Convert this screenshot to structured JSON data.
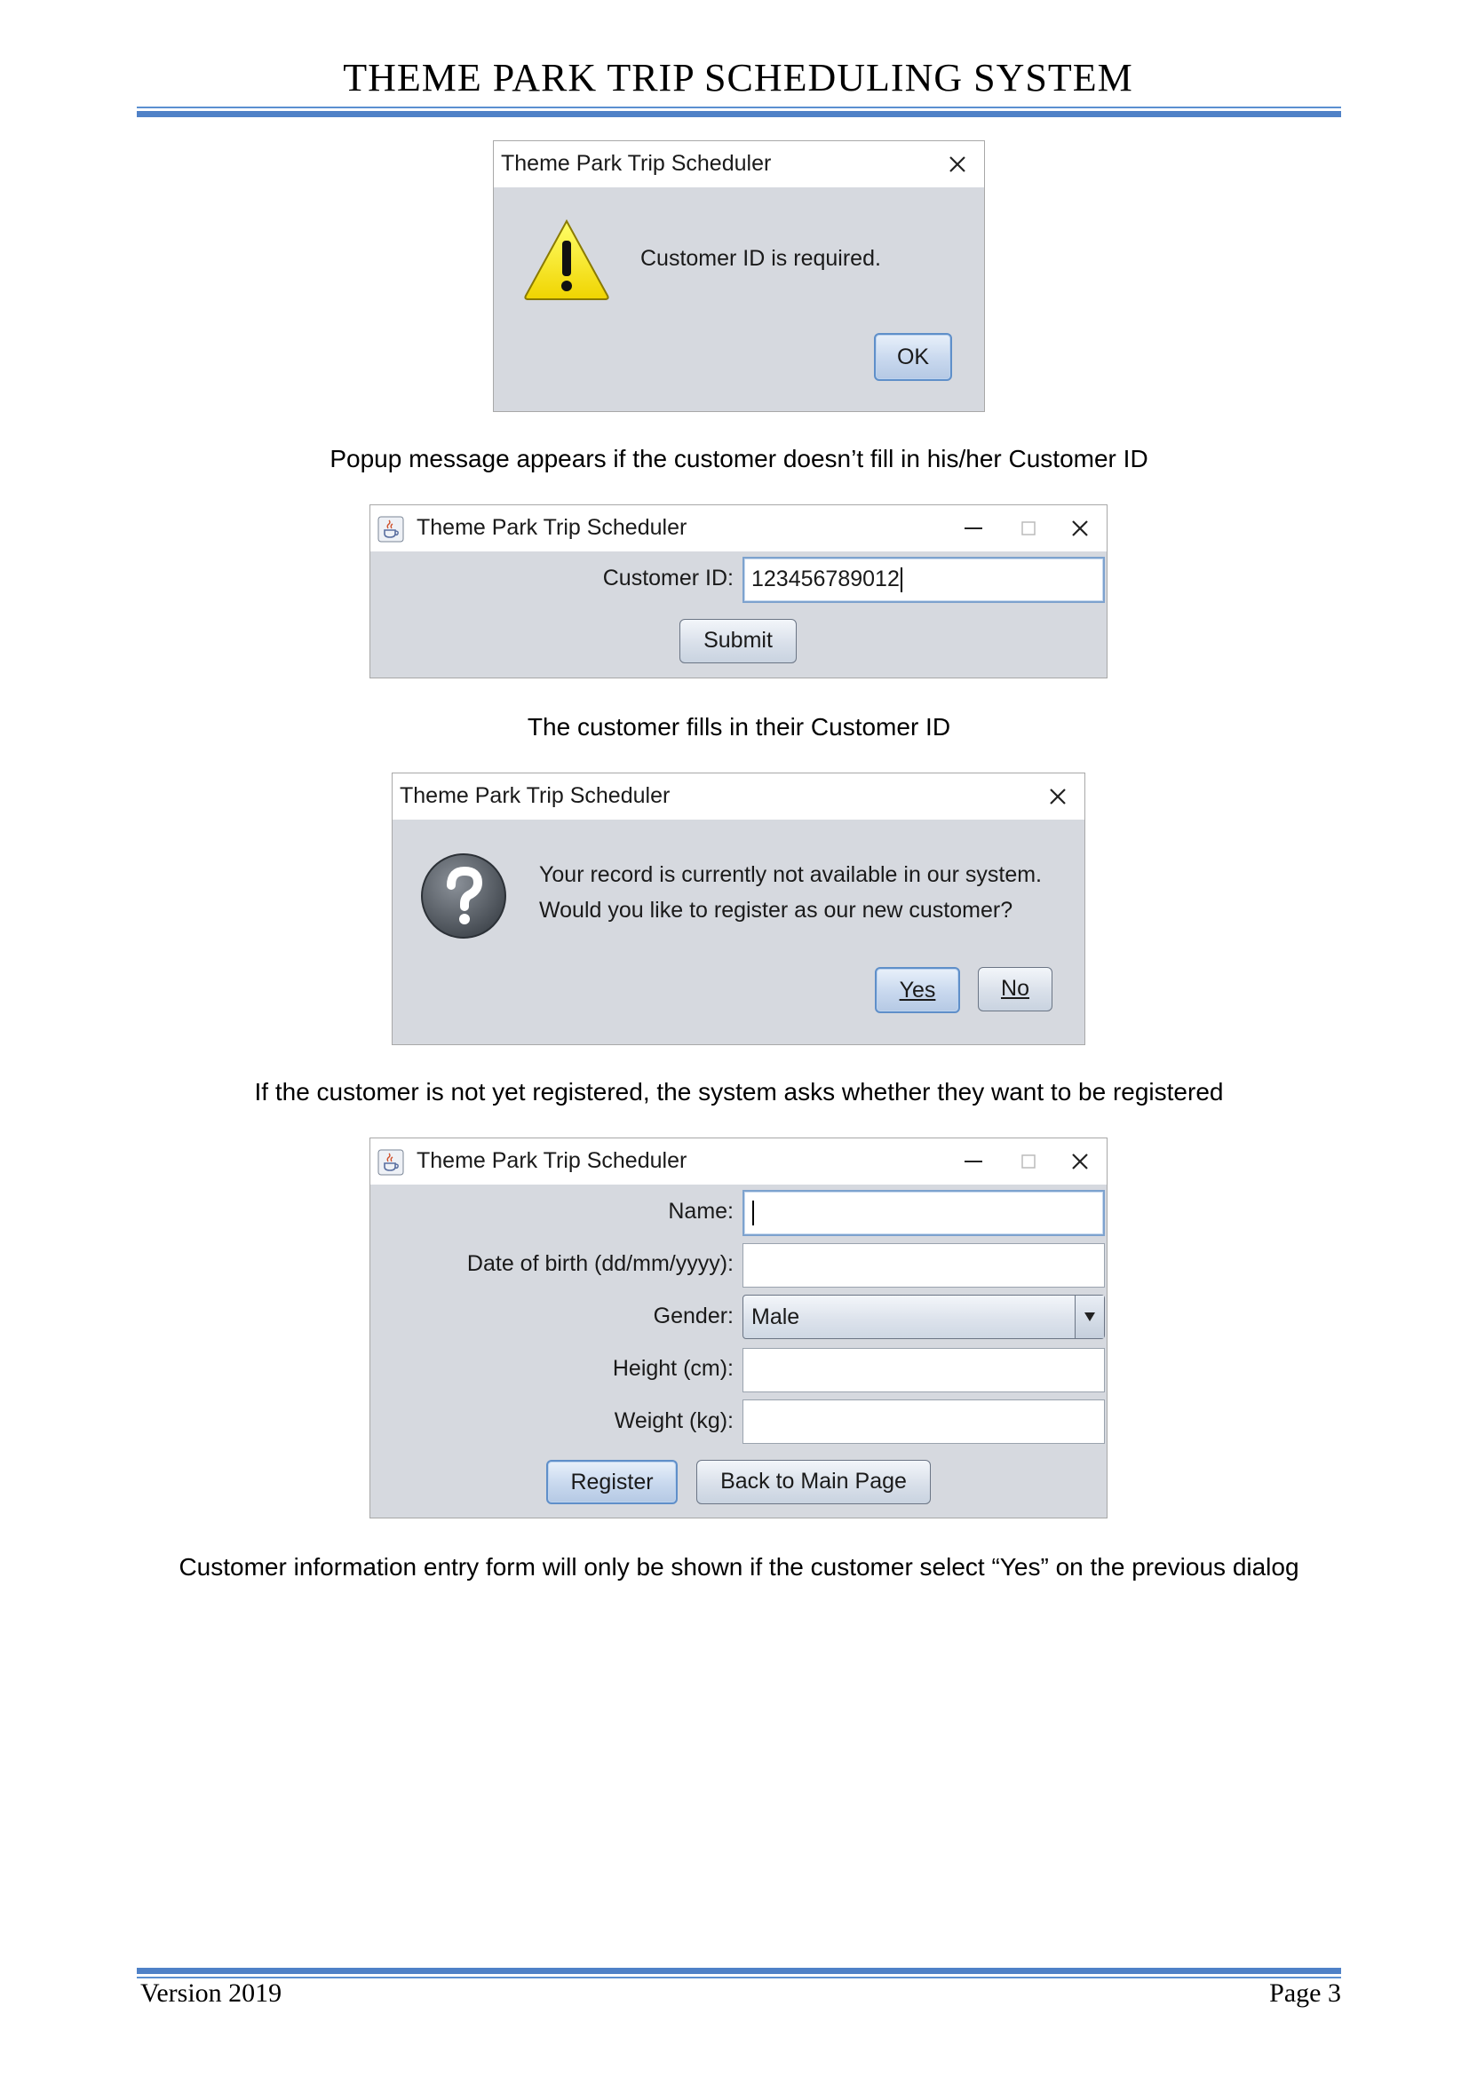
{
  "document": {
    "title": "THEME PARK TRIP SCHEDULING SYSTEM",
    "footer_left": "Version 2019",
    "footer_right": "Page 3"
  },
  "dialog_warning": {
    "title": "Theme Park Trip Scheduler",
    "message": "Customer ID is required.",
    "ok_label": "OK",
    "caption": "Popup message appears if the customer doesn’t fill in his/her Customer ID"
  },
  "customer_id_window": {
    "title": "Theme Park Trip Scheduler",
    "label": "Customer ID:",
    "value": "123456789012",
    "submit_label": "Submit",
    "caption": "The customer fills in their Customer ID"
  },
  "dialog_question": {
    "title": "Theme Park Trip Scheduler",
    "message_line1": "Your record is currently not available in our system.",
    "message_line2": "Would you like to register as our new customer?",
    "yes_label": "Yes",
    "no_label": "No",
    "caption": "If the customer is not yet registered, the system asks whether they want to be registered"
  },
  "register_window": {
    "title": "Theme Park Trip Scheduler",
    "name_label": "Name:",
    "name_value": "",
    "dob_label": "Date of birth (dd/mm/yyyy):",
    "dob_value": "",
    "gender_label": "Gender:",
    "gender_value": "Male",
    "height_label": "Height (cm):",
    "height_value": "",
    "weight_label": "Weight (kg):",
    "weight_value": "",
    "register_label": "Register",
    "back_label": "Back to Main Page",
    "caption": "Customer information entry form will only be shown if the customer select “Yes” on the previous dialog"
  },
  "icons": {
    "warning": "warning-triangle-icon",
    "question": "question-circle-icon",
    "app": "java-cup-icon",
    "close": "close-icon",
    "minimize": "minimize-icon",
    "maximize": "maximize-icon",
    "dropdown": "chevron-down-icon"
  },
  "colors": {
    "rule": "#4f81c7",
    "dialog_bg": "#d6d9df",
    "focus_border": "#5f8fc9"
  }
}
